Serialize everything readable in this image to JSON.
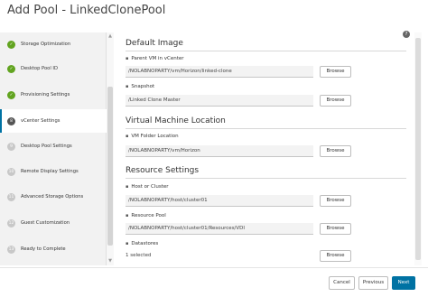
{
  "window": {
    "title": "Add Pool - LinkedClonePool"
  },
  "steps": [
    {
      "num": "✓",
      "label": "Storage Optimization",
      "state": "done"
    },
    {
      "num": "✓",
      "label": "Desktop Pool ID",
      "state": "done"
    },
    {
      "num": "✓",
      "label": "Provisioning Settings",
      "state": "done"
    },
    {
      "num": "8",
      "label": "vCenter Settings",
      "state": "active"
    },
    {
      "num": "9",
      "label": "Desktop Pool Settings",
      "state": "todo"
    },
    {
      "num": "10",
      "label": "Remote Display Settings",
      "state": "todo"
    },
    {
      "num": "11",
      "label": "Advanced Storage Options",
      "state": "todo"
    },
    {
      "num": "12",
      "label": "Guest Customization",
      "state": "todo"
    },
    {
      "num": "13",
      "label": "Ready to Complete",
      "state": "todo"
    }
  ],
  "help_icon": "?",
  "sections": {
    "default_image": {
      "title": "Default Image",
      "parent_vm": {
        "label": "Parent VM in vCenter",
        "value": "/NOLABNOPARTY/vm/Horizon/linked-clone",
        "browse": "Browse"
      },
      "snapshot": {
        "label": "Snapshot",
        "value": "/Linked Clone Master",
        "browse": "Browse"
      }
    },
    "vm_location": {
      "title": "Virtual Machine Location",
      "vm_folder": {
        "label": "VM Folder Location",
        "value": "/NOLABNOPARTY/vm/Horizon",
        "browse": "Browse"
      }
    },
    "resource_settings": {
      "title": "Resource Settings",
      "host_cluster": {
        "label": "Host or Cluster",
        "value": "/NOLABNOPARTY/host/cluster01",
        "browse": "Browse"
      },
      "resource_pool": {
        "label": "Resource Pool",
        "value": "/NOLABNOPARTY/host/cluster01/Resources/VDI",
        "browse": "Browse"
      },
      "datastores": {
        "label": "Datastores",
        "value": "1 selected",
        "browse": "Browse"
      }
    }
  },
  "footer": {
    "cancel": "Cancel",
    "previous": "Previous",
    "next": "Next"
  },
  "colors": {
    "accent": "#0072a3",
    "done": "#62a420"
  }
}
